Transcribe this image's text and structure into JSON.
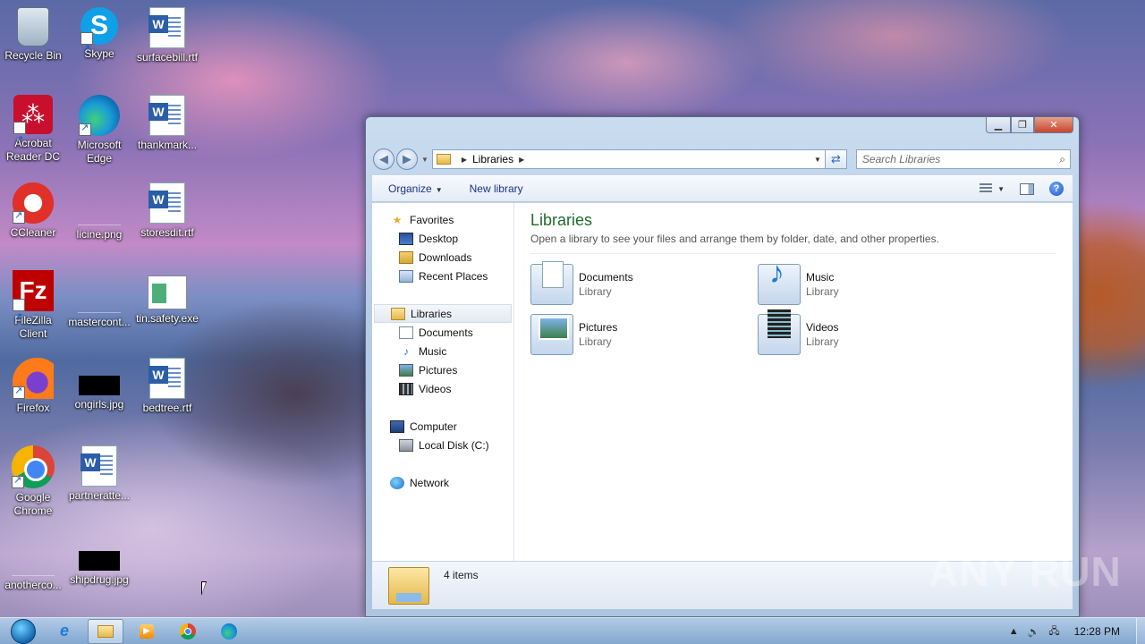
{
  "desktop": {
    "icons": [
      {
        "label": "Recycle Bin",
        "icon": "recycle-bin-icon"
      },
      {
        "label": "Skype",
        "icon": "skype-icon"
      },
      {
        "label": "surfacebill.rtf",
        "icon": "word-document-icon"
      },
      {
        "label": "Acrobat Reader DC",
        "icon": "acrobat-icon"
      },
      {
        "label": "Microsoft Edge",
        "icon": "edge-icon"
      },
      {
        "label": "thankmark...",
        "icon": "word-document-icon"
      },
      {
        "label": "CCleaner",
        "icon": "ccleaner-icon"
      },
      {
        "label": "licine.png",
        "icon": "image-file-icon"
      },
      {
        "label": "storesdit.rtf",
        "icon": "word-document-icon"
      },
      {
        "label": "FileZilla Client",
        "icon": "filezilla-icon"
      },
      {
        "label": "mastercont...",
        "icon": "image-file-icon"
      },
      {
        "label": "tin.safety.exe",
        "icon": "executable-icon"
      },
      {
        "label": "Firefox",
        "icon": "firefox-icon"
      },
      {
        "label": "ongirls.jpg",
        "icon": "image-file-icon"
      },
      {
        "label": "bedtree.rtf",
        "icon": "word-document-icon"
      },
      {
        "label": "Google Chrome",
        "icon": "chrome-icon"
      },
      {
        "label": "partneratte...",
        "icon": "word-document-icon"
      },
      {
        "label": "anotherco...",
        "icon": "image-file-icon"
      },
      {
        "label": "shipdrug.jpg",
        "icon": "image-file-icon"
      }
    ]
  },
  "window": {
    "address": {
      "crumb": "Libraries"
    },
    "search": {
      "placeholder": "Search Libraries"
    },
    "toolbar": {
      "organize_label": "Organize",
      "new_library_label": "New library"
    },
    "nav_pane": {
      "favorites": "Favorites",
      "desktop": "Desktop",
      "downloads": "Downloads",
      "recent_places": "Recent Places",
      "libraries": "Libraries",
      "documents": "Documents",
      "music": "Music",
      "pictures": "Pictures",
      "videos": "Videos",
      "computer": "Computer",
      "local_disk": "Local Disk (C:)",
      "network": "Network"
    },
    "main": {
      "title": "Libraries",
      "description": "Open a library to see your files and arrange them by folder, date, and other properties.",
      "libraries": [
        {
          "name": "Documents",
          "type": "Library"
        },
        {
          "name": "Music",
          "type": "Library"
        },
        {
          "name": "Pictures",
          "type": "Library"
        },
        {
          "name": "Videos",
          "type": "Library"
        }
      ]
    },
    "status": {
      "item_count": "4 items"
    }
  },
  "taskbar": {
    "clock": "12:28 PM"
  },
  "watermark": "ANY RUN"
}
